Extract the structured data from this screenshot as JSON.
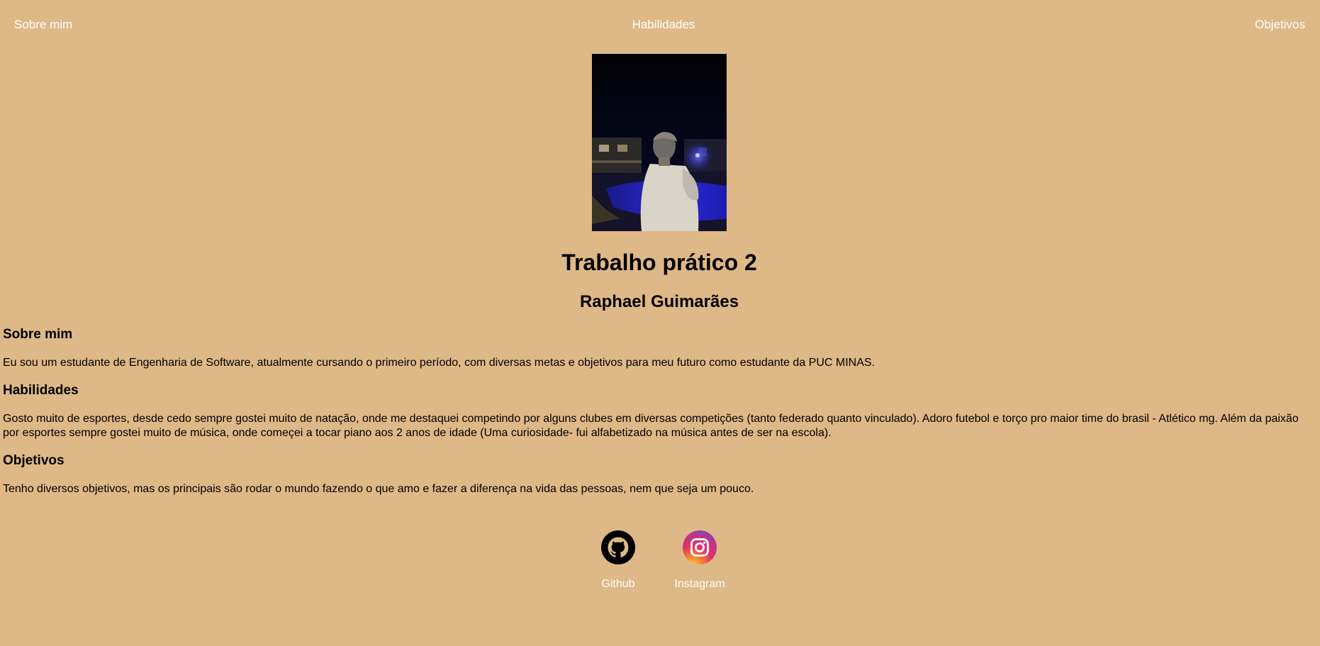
{
  "nav": {
    "left_label": "Sobre mim",
    "center_label": "Habilidades",
    "right_label": "Objetivos"
  },
  "profile": {
    "photo_icon": "profile-photo",
    "title": "Trabalho prático 2",
    "name": "Raphael Guimarães"
  },
  "sections": [
    {
      "heading": "Sobre mim",
      "text": "Eu sou um estudante de Engenharia de Software, atualmente cursando o primeiro período, com diversas metas e objetivos para meu futuro como estudante da PUC MINAS."
    },
    {
      "heading": "Habilidades",
      "text": "Gosto muito de esportes, desde cedo sempre gostei muito de natação, onde me destaquei competindo por alguns clubes em diversas competições (tanto federado quanto vinculado). Adoro futebol e torço pro maior time do brasil - Atlético mg. Além da paixão por esportes sempre gostei muito de música, onde começei a tocar piano aos 2 anos de idade (Uma curiosidade- fui alfabetizado na música antes de ser na escola)."
    },
    {
      "heading": "Objetivos",
      "text": "Tenho diversos objetivos, mas os principais são rodar o mundo fazendo o que amo e fazer a diferença na vida das pessoas, nem que seja um pouco."
    }
  ],
  "social": {
    "github": {
      "label": "Github",
      "icon": "github-icon"
    },
    "instagram": {
      "label": "Instagram",
      "icon": "instagram-icon"
    }
  },
  "colors": {
    "background": "#deb887",
    "link_text": "#ffffff",
    "body_text": "#000000"
  }
}
